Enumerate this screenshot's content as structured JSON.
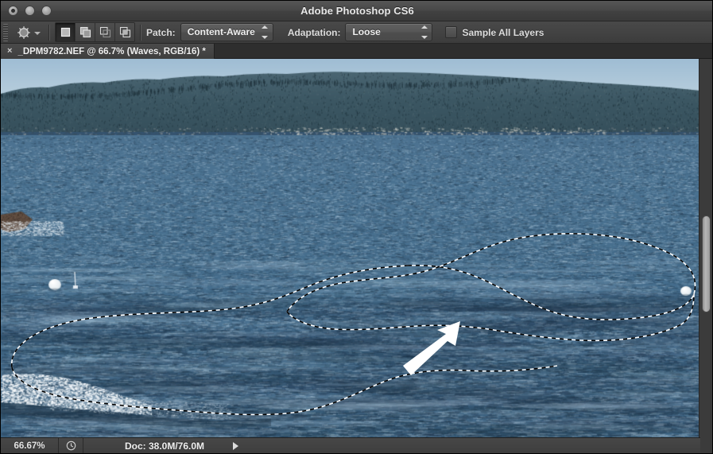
{
  "window": {
    "title": "Adobe Photoshop CS6",
    "controls": [
      "close-button",
      "minimize-button",
      "zoom-button"
    ]
  },
  "options_bar": {
    "tool_icon": "patch-tool-icon",
    "tool_preset_caret": "chevron-down-icon",
    "selection_modes": [
      {
        "name": "new-selection",
        "active": true
      },
      {
        "name": "add-to-selection",
        "active": false
      },
      {
        "name": "subtract-from-selection",
        "active": false
      },
      {
        "name": "intersect-with-selection",
        "active": false
      }
    ],
    "patch_label": "Patch:",
    "patch_value": "Content-Aware",
    "adaptation_label": "Adaptation:",
    "adaptation_value": "Loose",
    "sample_all_layers_label": "Sample All Layers",
    "sample_all_layers_checked": false
  },
  "document_tab": {
    "close_glyph": "×",
    "title": "_DPM9782.NEF @ 66.7% (Waves, RGB/16) *"
  },
  "status_bar": {
    "zoom": "66.67%",
    "timing_icon": "clock-icon",
    "doc_label": "Doc: 38.0M/76.0M",
    "expand_glyph": "play-triangle-icon"
  },
  "canvas": {
    "image_description": "Coastal seascape: forested headland on horizon, rippled blue ocean, whitecap surf at left, two white buoys",
    "selection_state": "active marching-ants lasso selection over water",
    "annotation": "white arrow pointing up-right"
  },
  "colors": {
    "chrome_light": "#4a4a4a",
    "chrome_dark": "#333333",
    "text": "#e8e8e8",
    "water_mid": "#4a7394",
    "water_dark": "#2f4d69",
    "sky": "#a9c4d8",
    "forest": "#3c5663",
    "arrow": "#ffffff"
  }
}
